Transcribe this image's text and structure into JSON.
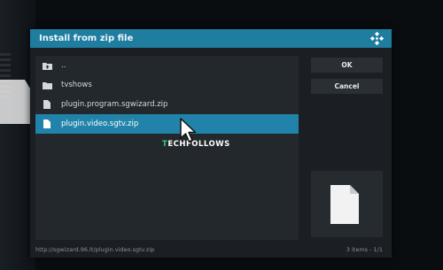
{
  "dialog": {
    "title": "Install from zip file",
    "icon": "kodi-logo-icon"
  },
  "file_list": {
    "items": [
      {
        "label": "..",
        "icon": "folder-up-icon"
      },
      {
        "label": "tvshows",
        "icon": "folder-icon"
      },
      {
        "label": "plugin.program.sgwizard.zip",
        "icon": "file-icon"
      },
      {
        "label": "plugin.video.sgtv.zip",
        "icon": "file-icon",
        "selected": true
      }
    ]
  },
  "buttons": {
    "ok": "OK",
    "cancel": "Cancel"
  },
  "footer": {
    "path": "http://sgwizard.96.lt/plugin.video.sgtv.zip",
    "count": "3 items - 1/1"
  },
  "watermark": {
    "first_letter": "T",
    "rest": "ECHFOLLOWS"
  },
  "colors": {
    "accent": "#2183a9",
    "titlebar": "#1f7da0",
    "panel": "#23282d"
  }
}
